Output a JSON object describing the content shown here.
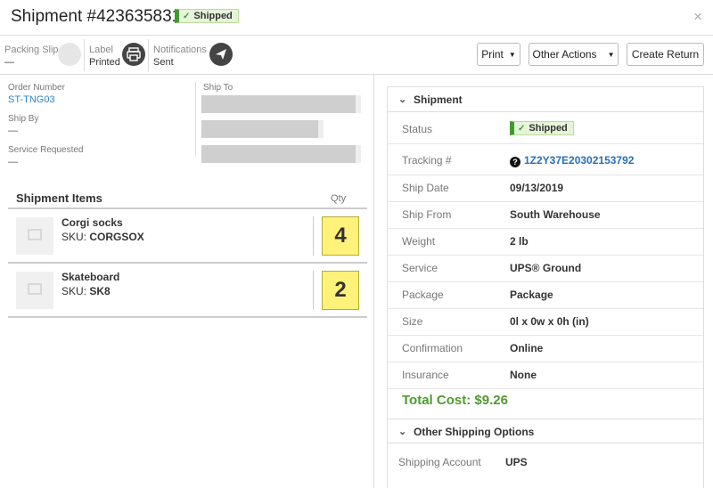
{
  "header": {
    "title": "Shipment #423635831",
    "status_badge": "Shipped",
    "close_glyph": "×"
  },
  "toolbar": {
    "packing_slip": {
      "label": "Packing Slip",
      "value": "—"
    },
    "label": {
      "label": "Label",
      "value": "Printed",
      "icon": "printer-icon"
    },
    "notifications": {
      "label": "Notifications",
      "value": "Sent",
      "icon": "paper-plane-icon"
    },
    "buttons": {
      "print": "Print",
      "other_actions": "Other Actions",
      "create_return": "Create Return"
    }
  },
  "order": {
    "order_number_label": "Order Number",
    "order_number": "ST-TNG03",
    "ship_by_label": "Ship By",
    "ship_by": "—",
    "service_requested_label": "Service Requested",
    "service_requested": "—",
    "ship_to_label": "Ship To"
  },
  "items": {
    "title": "Shipment Items",
    "qty_header": "Qty",
    "list": [
      {
        "name": "Corgi socks",
        "sku_label": "SKU:",
        "sku": "CORGSOX",
        "qty": "4"
      },
      {
        "name": "Skateboard",
        "sku_label": "SKU:",
        "sku": "SK8",
        "qty": "2"
      }
    ]
  },
  "shipment": {
    "section_title": "Shipment",
    "status_label": "Status",
    "status_badge": "Shipped",
    "tracking_label": "Tracking #",
    "tracking_help": "?",
    "tracking_number": "1Z2Y37E20302153792",
    "ship_date_label": "Ship Date",
    "ship_date": "09/13/2019",
    "ship_from_label": "Ship From",
    "ship_from": "South Warehouse",
    "weight_label": "Weight",
    "weight": "2 lb",
    "service_label": "Service",
    "service": "UPS® Ground",
    "package_label": "Package",
    "package": "Package",
    "size_label": "Size",
    "size": "0l x 0w x 0h (in)",
    "confirmation_label": "Confirmation",
    "confirmation": "Online",
    "insurance_label": "Insurance",
    "insurance": "None",
    "total_cost": "Total Cost: $9.26"
  },
  "other_options": {
    "section_title": "Other Shipping Options",
    "account_label": "Shipping Account",
    "account": "UPS"
  },
  "colors": {
    "accent_green": "#3f9b2f",
    "link_blue": "#2a86c8",
    "qty_yellow": "#fff27a",
    "total_green": "#4f9a2f"
  }
}
